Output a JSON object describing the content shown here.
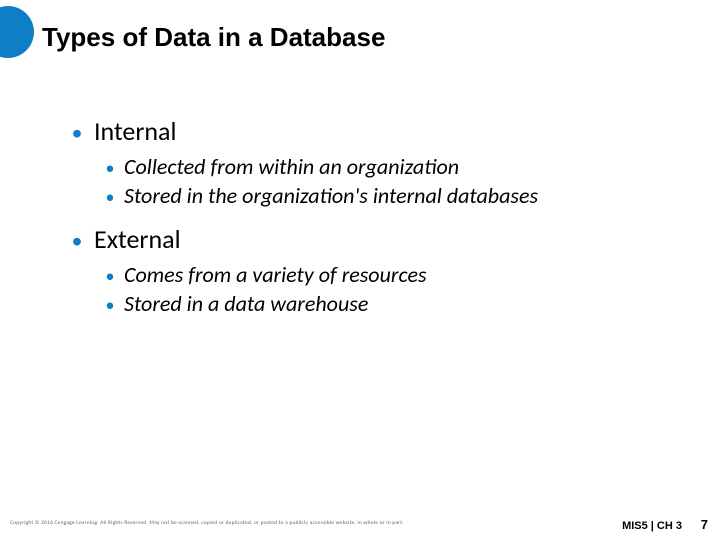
{
  "title": "Types of Data in a Database",
  "bullets": [
    {
      "text": "Internal",
      "sub": [
        "Collected from within an organization",
        "Stored in the organization's internal databases"
      ]
    },
    {
      "text": "External",
      "sub": [
        "Comes from a variety of resources",
        "Stored in a data warehouse"
      ]
    }
  ],
  "footer": {
    "copyright": "Copyright © 2016 Cengage Learning. All Rights Reserved. May not be scanned, copied or duplicated, or posted to a publicly accessible website, in whole or in part.",
    "chapter": "MIS5 | CH 3",
    "page": "7"
  }
}
